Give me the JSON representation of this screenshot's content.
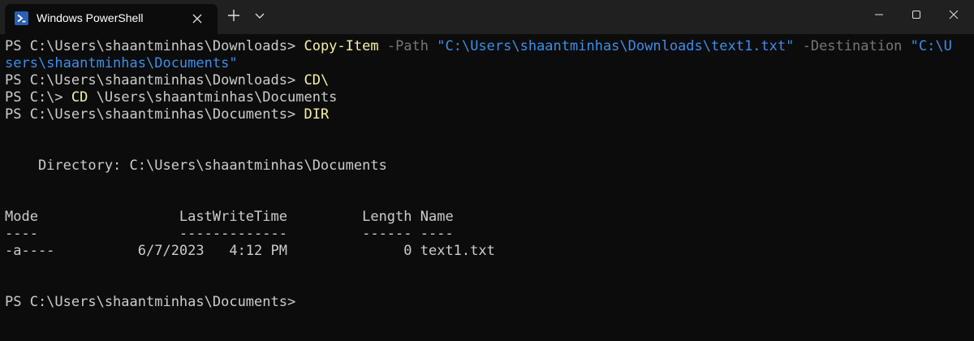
{
  "window": {
    "tab_title": "Windows PowerShell",
    "icons": {
      "tab": "powershell-icon",
      "close_tab": "close-icon",
      "new_tab": "plus-icon",
      "dropdown": "chevron-down-icon",
      "minimize": "minimize-icon",
      "maximize": "maximize-icon",
      "close_window": "close-icon"
    }
  },
  "colors": {
    "background": "#0c0c0c",
    "titlebar": "#202020",
    "text": "#cccccc",
    "command": "#f9f1a5",
    "parameter": "#767676",
    "string": "#3b8eea"
  },
  "terminal": {
    "line1": {
      "prompt": "PS C:\\Users\\shaantminhas\\Downloads> ",
      "cmdlet": "Copy-Item",
      "param_path": " -Path ",
      "path_value": "\"C:\\Users\\shaantminhas\\Downloads\\text1.txt\"",
      "param_dest": " -Destination ",
      "dest_value_start": "\"C:\\U"
    },
    "line2": {
      "dest_value_end": "sers\\shaantminhas\\Documents\""
    },
    "line3": {
      "prompt": "PS C:\\Users\\shaantminhas\\Downloads> ",
      "command": "CD\\"
    },
    "line4": {
      "prompt": "PS C:\\> ",
      "command": "CD",
      "argument": " \\Users\\shaantminhas\\Documents"
    },
    "line5": {
      "prompt": "PS C:\\Users\\shaantminhas\\Documents> ",
      "command": "DIR"
    },
    "directory_line": "    Directory: C:\\Users\\shaantminhas\\Documents",
    "header_line": "Mode                 LastWriteTime         Length Name",
    "separator_line": "----                 -------------         ------ ----",
    "file_rows": [
      "-a----          6/7/2023   4:12 PM              0 text1.txt"
    ],
    "final_prompt": "PS C:\\Users\\shaantminhas\\Documents>"
  }
}
